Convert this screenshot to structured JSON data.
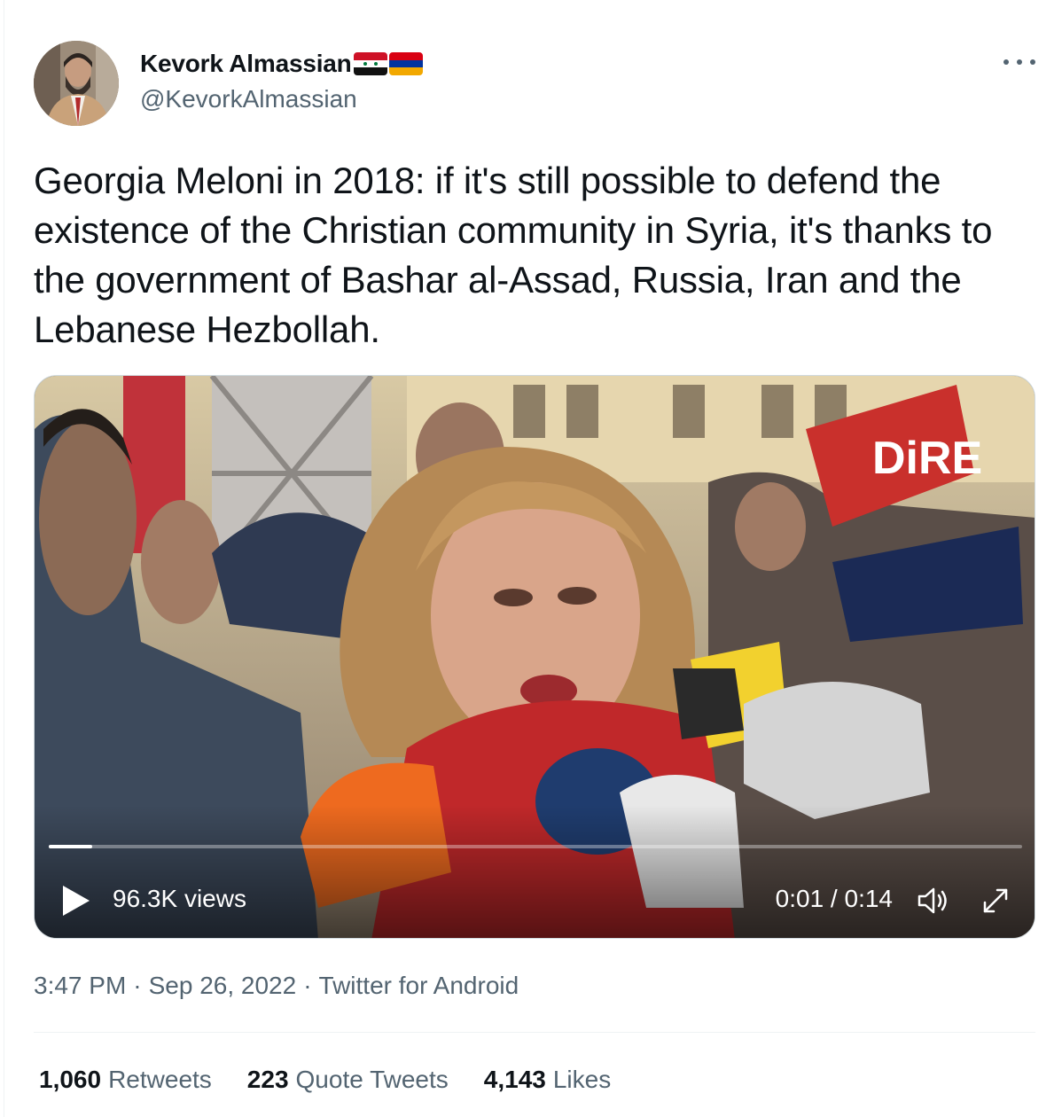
{
  "author": {
    "display_name": "Kevork Almassian",
    "handle": "@KevorkAlmassian",
    "flags": [
      "syria-flag-icon",
      "armenia-flag-icon"
    ]
  },
  "menu": {
    "icon": "more-options-icon"
  },
  "tweet": {
    "text": "Georgia Meloni in 2018: if it's still possible to defend the existence of the Christian community in Syria, it's thanks to the government of Bashar al-Assad, Russia, Iran and the Lebanese Hezbollah."
  },
  "video": {
    "watermark": "DiRE",
    "views": "96.3K views",
    "time": "0:01 / 0:14",
    "progress": 0.045,
    "icons": [
      "play-icon",
      "volume-icon",
      "fullscreen-icon"
    ]
  },
  "meta": {
    "time": "3:47 PM",
    "date": "Sep 26, 2022",
    "source": "Twitter for Android",
    "separator": "·"
  },
  "stats": [
    {
      "count": "1,060",
      "label": "Retweets"
    },
    {
      "count": "223",
      "label": "Quote Tweets"
    },
    {
      "count": "4,143",
      "label": "Likes"
    }
  ],
  "colors": {
    "text_primary": "#0f1419",
    "text_secondary": "#536471",
    "divider": "#eff3f4"
  }
}
